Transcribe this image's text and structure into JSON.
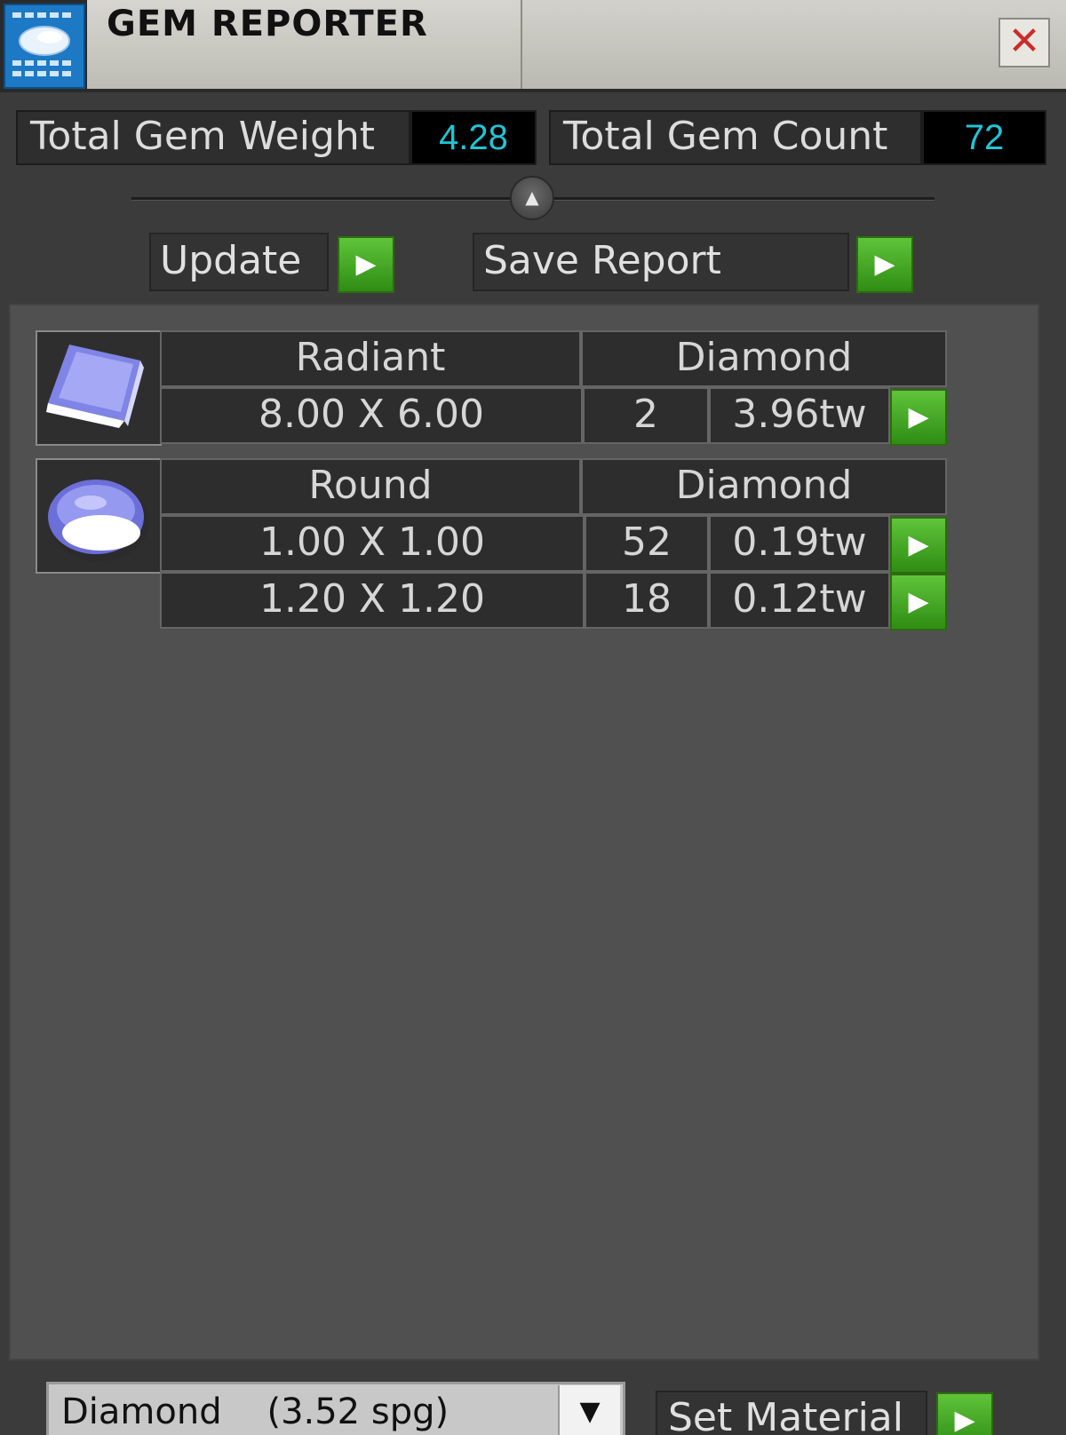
{
  "window": {
    "title": "GEM REPORTER",
    "close_glyph": "✕",
    "app_icon": "gem-reporter-app-icon"
  },
  "totals": {
    "weight_label": "Total Gem Weight",
    "weight_value": "4.28",
    "count_label": "Total Gem Count",
    "count_value": "72",
    "value_color": "#1fc6d6"
  },
  "toolbar": {
    "update_label": "Update",
    "save_report_label": "Save Report",
    "collapse_glyph": "▲"
  },
  "gem_groups": [
    {
      "icon": "radiant-gem-icon",
      "shape": "Radiant",
      "material": "Diamond",
      "rows": [
        {
          "size": "8.00 X 6.00",
          "count": "2",
          "weight": "3.96tw"
        }
      ]
    },
    {
      "icon": "round-gem-icon",
      "shape": "Round",
      "material": "Diamond",
      "rows": [
        {
          "size": "1.00 X 1.00",
          "count": "52",
          "weight": "0.19tw"
        },
        {
          "size": "1.20 X 1.20",
          "count": "18",
          "weight": "0.12tw"
        }
      ]
    }
  ],
  "material": {
    "selected": "Diamond    (3.52 spg)",
    "set_material_label": "Set Material"
  },
  "colors": {
    "go_button": "#3fa81f",
    "panel_bg": "#505050",
    "window_bg": "#3b3b3b"
  }
}
